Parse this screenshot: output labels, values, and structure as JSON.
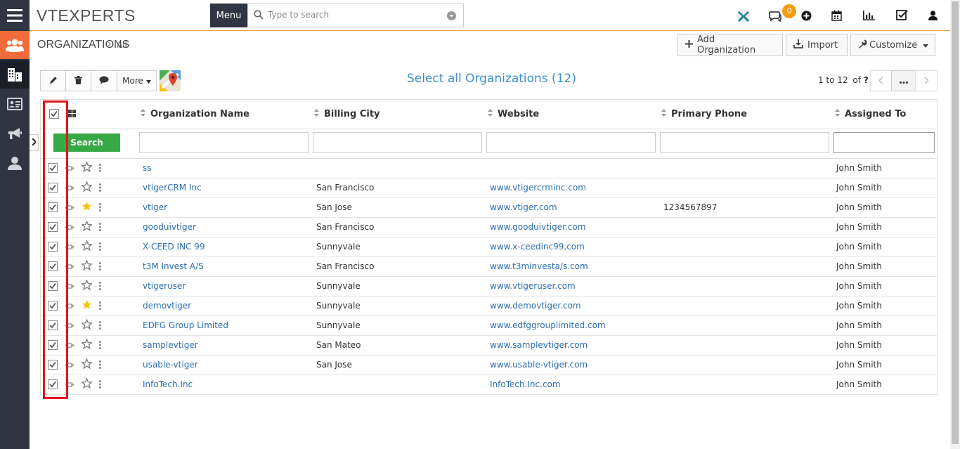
{
  "topbar": {
    "logo": "VTEXPERTS",
    "menu_label": "Menu",
    "search_placeholder": "Type to search",
    "notification_count": "0"
  },
  "rail": {
    "items": [
      "hamburger-menu",
      "contacts-group",
      "organizations",
      "business-card",
      "campaigns",
      "user"
    ]
  },
  "header": {
    "module_title": "ORGANIZATIONS",
    "breadcrumb_sep": "›",
    "filter": "All",
    "add_label": "Add Organization",
    "import_label": "Import",
    "customize_label": "Customize"
  },
  "toolbar": {
    "more_label": "More",
    "select_all": "Select all Organizations (12)",
    "pager": "1 to 12",
    "pager_of": "of",
    "pager_unknown": "?"
  },
  "table": {
    "columns": [
      "Organization Name",
      "Billing City",
      "Website",
      "Primary Phone",
      "Assigned To"
    ],
    "search_label": "Search",
    "rows": [
      {
        "name": "ss",
        "city": "",
        "website": "",
        "phone": "",
        "assigned": "John Smith",
        "starred": false
      },
      {
        "name": "vtigerCRM Inc",
        "city": "San Francisco",
        "website": "www.vtigercrminc.com",
        "phone": "",
        "assigned": "John Smith",
        "starred": false
      },
      {
        "name": "vtiger",
        "city": "San Jose",
        "website": "www.vtiger.com",
        "phone": "1234567897",
        "assigned": "John Smith",
        "starred": true
      },
      {
        "name": "gooduivtiger",
        "city": "San Francisco",
        "website": "www.gooduivtiger.com",
        "phone": "",
        "assigned": "John Smith",
        "starred": false
      },
      {
        "name": "X-CEED INC 99",
        "city": "Sunnyvale",
        "website": "www.x-ceedinc99.com",
        "phone": "",
        "assigned": "John Smith",
        "starred": false
      },
      {
        "name": "t3M Invest A/S",
        "city": "San Francisco",
        "website": "www.t3minvesta/s.com",
        "phone": "",
        "assigned": "John Smith",
        "starred": false
      },
      {
        "name": "vtigeruser",
        "city": "Sunnyvale",
        "website": "www.vtigeruser.com",
        "phone": "",
        "assigned": "John Smith",
        "starred": false
      },
      {
        "name": "demovtiger",
        "city": "Sunnyvale",
        "website": "www.demovtiger.com",
        "phone": "",
        "assigned": "John Smith",
        "starred": true
      },
      {
        "name": "EDFG Group Limited",
        "city": "Sunnyvale",
        "website": "www.edfggrouplimited.com",
        "phone": "",
        "assigned": "John Smith",
        "starred": false
      },
      {
        "name": "samplevtiger",
        "city": "San Mateo",
        "website": "www.samplevtiger.com",
        "phone": "",
        "assigned": "John Smith",
        "starred": false
      },
      {
        "name": "usable-vtiger",
        "city": "San Jose",
        "website": "www.usable-vtiger.com",
        "phone": "",
        "assigned": "John Smith",
        "starred": false
      },
      {
        "name": "InfoTech.Inc",
        "city": "",
        "website": "InfoTech.Inc.com",
        "phone": "",
        "assigned": "John Smith",
        "starred": false
      }
    ]
  },
  "colors": {
    "rail": "#2f3542",
    "accent_orange": "#f26b3a",
    "link": "#2c6fb3",
    "search_green": "#36a845",
    "highlight_red": "#e0151b",
    "star_gold": "#f4c20d"
  }
}
